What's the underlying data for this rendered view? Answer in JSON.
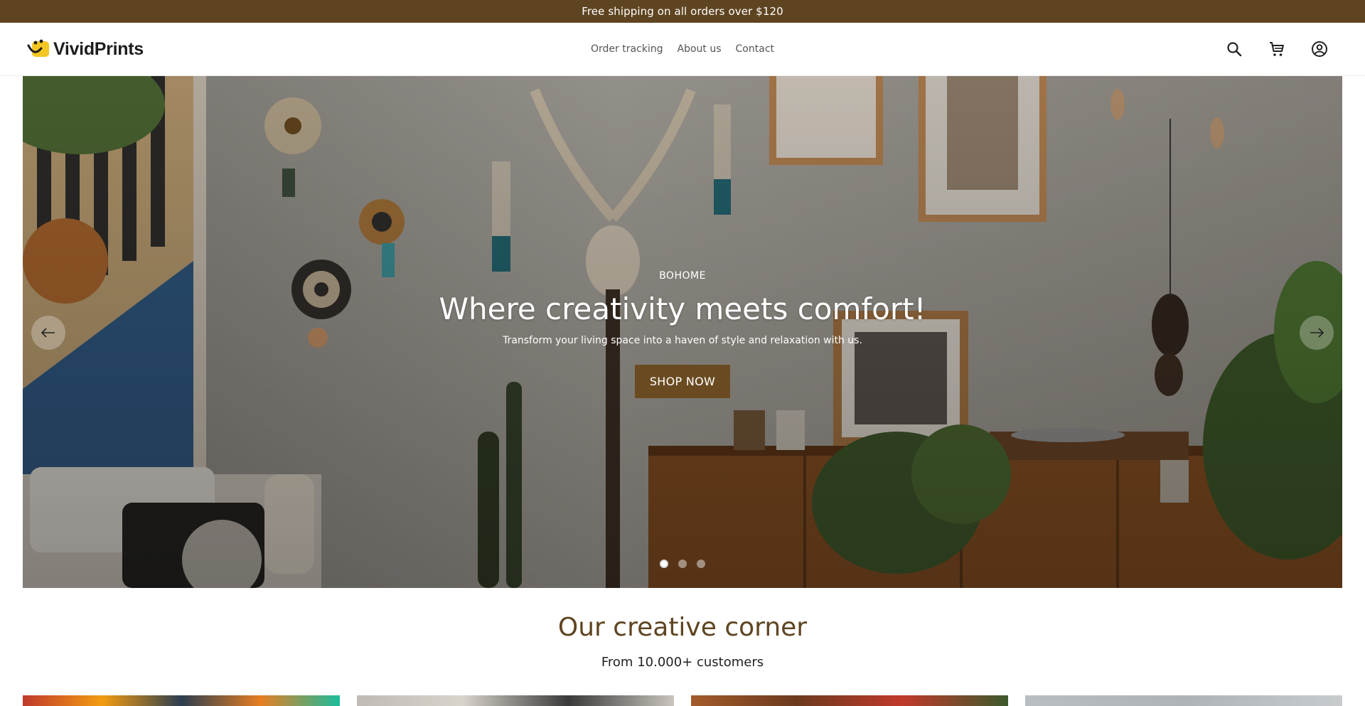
{
  "announcement": {
    "text": "Free shipping on all orders over $120"
  },
  "brand": {
    "name": "VividPrints",
    "accent": "#5e4420",
    "logo_color": "#f3c623"
  },
  "nav": {
    "items": [
      {
        "label": "Order tracking"
      },
      {
        "label": "About us"
      },
      {
        "label": "Contact"
      }
    ]
  },
  "header_icons": [
    "search-icon",
    "cart-icon",
    "account-icon"
  ],
  "hero": {
    "eyebrow": "BOHOME",
    "title": "Where creativity meets comfort!",
    "subtitle": "Transform your living space into a haven of style and relaxation with us.",
    "cta": "SHOP NOW",
    "slides": 3,
    "active_slide": 1
  },
  "section": {
    "title": "Our creative corner",
    "subtitle": "From 10.000+ customers"
  }
}
